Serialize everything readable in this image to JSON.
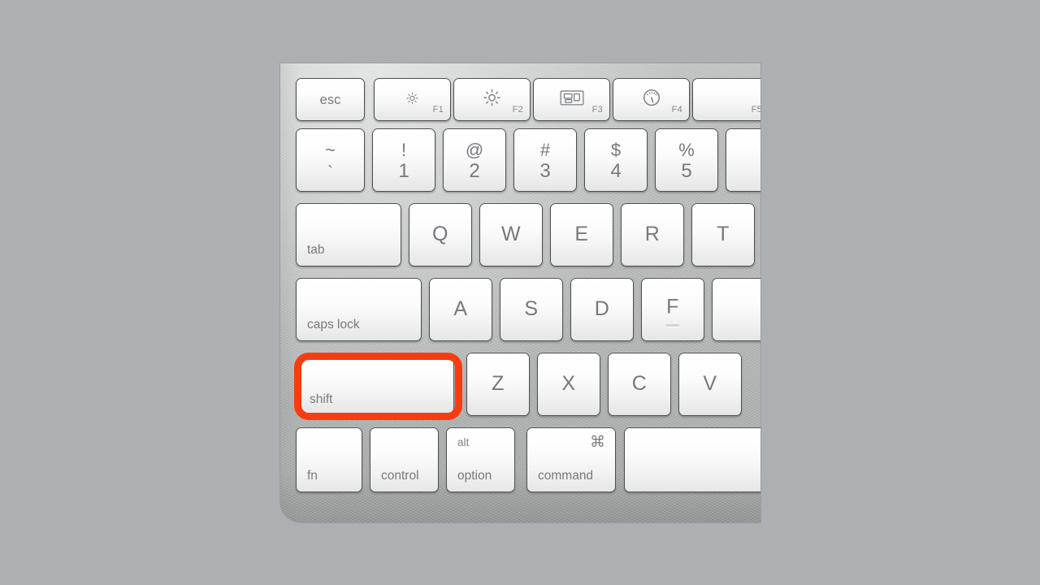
{
  "scene": {
    "title": "Mac keyboard with shift key highlighted",
    "background_color": "#acb0b3",
    "keyboard_body_color": "#b5b7b7",
    "key_face_color": "#fbfbfb",
    "key_label_color": "#76797c",
    "highlight_color": "#f83c0f"
  },
  "highlight": {
    "target_key": "shift",
    "shape": "rounded-rectangle-outline",
    "color": "#f83c0f",
    "thickness_px": 9
  },
  "rows": [
    {
      "name": "function-row",
      "keys": [
        {
          "id": "esc",
          "label": "esc",
          "style": "word-center"
        },
        {
          "id": "f1",
          "label": "",
          "fn": "F1",
          "icon": "brightness-down-icon",
          "style": "icon-fn"
        },
        {
          "id": "f2",
          "label": "",
          "fn": "F2",
          "icon": "brightness-up-icon",
          "style": "icon-fn"
        },
        {
          "id": "f3",
          "label": "",
          "fn": "F3",
          "icon": "mission-control-icon",
          "style": "icon-fn"
        },
        {
          "id": "f4",
          "label": "",
          "fn": "F4",
          "icon": "dashboard-gauge-icon",
          "style": "icon-fn"
        },
        {
          "id": "f5",
          "label": "",
          "fn": "F5",
          "icon": "",
          "style": "icon-fn"
        }
      ]
    },
    {
      "name": "number-row",
      "keys": [
        {
          "id": "tilde",
          "top": "~",
          "bottom": "`",
          "style": "two-glyph"
        },
        {
          "id": "one",
          "top": "!",
          "bottom": "1",
          "style": "two-glyph"
        },
        {
          "id": "two",
          "top": "@",
          "bottom": "2",
          "style": "two-glyph"
        },
        {
          "id": "three",
          "top": "#",
          "bottom": "3",
          "style": "two-glyph"
        },
        {
          "id": "four",
          "top": "$",
          "bottom": "4",
          "style": "two-glyph"
        },
        {
          "id": "five",
          "top": "%",
          "bottom": "5",
          "style": "two-glyph"
        },
        {
          "id": "six",
          "top": "",
          "bottom": "",
          "style": "two-glyph"
        }
      ]
    },
    {
      "name": "tab-row",
      "keys": [
        {
          "id": "tab",
          "label": "tab",
          "style": "word-bottom-left"
        },
        {
          "id": "q",
          "label": "Q",
          "style": "letter"
        },
        {
          "id": "w",
          "label": "W",
          "style": "letter"
        },
        {
          "id": "e",
          "label": "E",
          "style": "letter"
        },
        {
          "id": "r",
          "label": "R",
          "style": "letter"
        },
        {
          "id": "t",
          "label": "T",
          "style": "letter"
        }
      ]
    },
    {
      "name": "home-row",
      "keys": [
        {
          "id": "caps-lock",
          "label": "caps lock",
          "style": "word-bottom-left"
        },
        {
          "id": "a",
          "label": "A",
          "style": "letter"
        },
        {
          "id": "s",
          "label": "S",
          "style": "letter"
        },
        {
          "id": "d",
          "label": "D",
          "style": "letter"
        },
        {
          "id": "f",
          "label": "F",
          "style": "letter",
          "tactile_bump": true
        },
        {
          "id": "g",
          "label": "",
          "style": "letter"
        }
      ]
    },
    {
      "name": "shift-row",
      "keys": [
        {
          "id": "shift",
          "label": "shift",
          "style": "word-bottom-left",
          "highlighted": true
        },
        {
          "id": "z",
          "label": "Z",
          "style": "letter"
        },
        {
          "id": "x",
          "label": "X",
          "style": "letter"
        },
        {
          "id": "c",
          "label": "C",
          "style": "letter"
        },
        {
          "id": "v",
          "label": "V",
          "style": "letter"
        }
      ]
    },
    {
      "name": "modifier-row",
      "keys": [
        {
          "id": "fn",
          "label": "fn",
          "style": "word-bottom-left"
        },
        {
          "id": "control",
          "label": "control",
          "style": "word-bottom-left"
        },
        {
          "id": "option",
          "label": "option",
          "alt": "alt",
          "style": "word-bottom-left-with-top"
        },
        {
          "id": "command",
          "label": "command",
          "glyph": "⌘",
          "style": "word-bottom-left-with-glyph"
        },
        {
          "id": "space",
          "label": "",
          "style": "blank"
        }
      ]
    }
  ]
}
